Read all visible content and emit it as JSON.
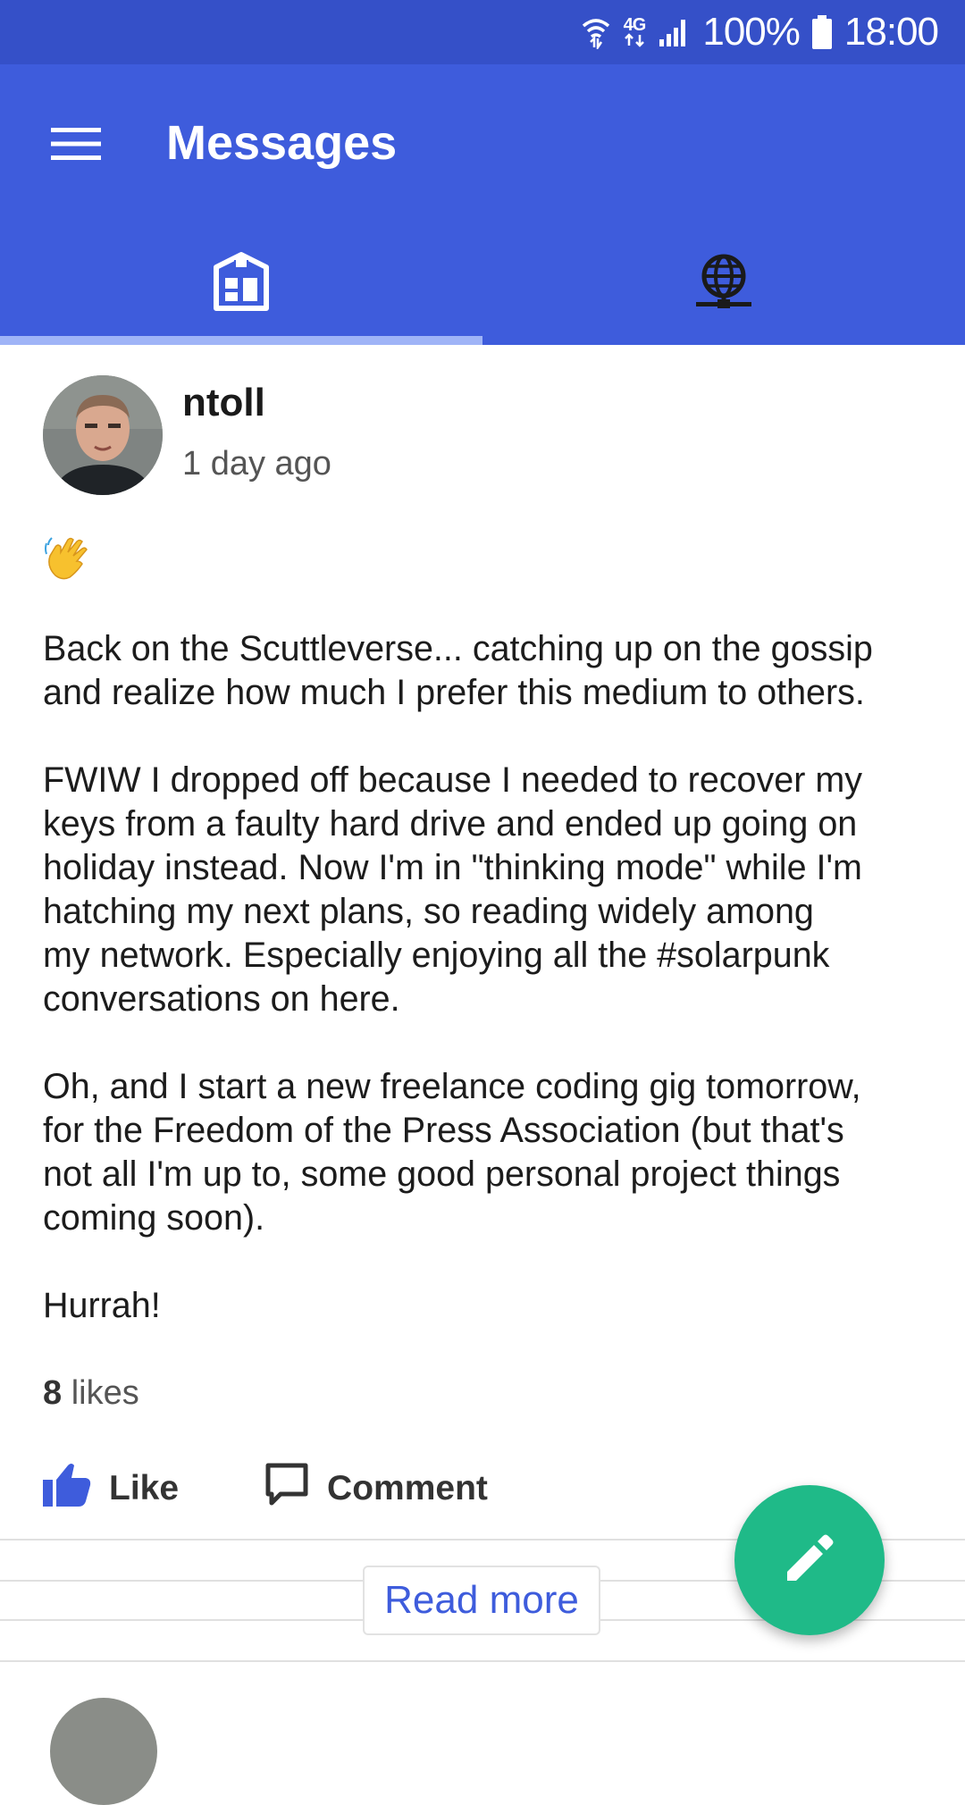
{
  "status_bar": {
    "network_label": "4G",
    "battery_text": "100%",
    "time": "18:00",
    "icons": [
      "wifi-icon",
      "network-4g-icon",
      "signal-icon",
      "battery-icon"
    ]
  },
  "app_bar": {
    "title": "Messages",
    "menu_icon": "hamburger-menu-icon",
    "background_color": "#3e5cdc",
    "tabs": [
      {
        "icon": "public-feed-icon",
        "selected": true
      },
      {
        "icon": "globe-network-icon",
        "selected": false
      }
    ]
  },
  "post": {
    "author": "ntoll",
    "timestamp": "1 day ago",
    "emoji": "👋",
    "paragraphs": [
      "Back on the Scuttleverse... catching up on the gossip\nand realize how much I prefer this medium to others.",
      "FWIW I dropped off because I needed to recover my\nkeys from a faulty hard drive and ended up going on\nholiday instead. Now I'm in \"thinking mode\" while I'm\nhatching my next plans, so reading widely among\nmy network. Especially enjoying all the #solarpunk\nconversations on here.",
      "Oh, and I start a new freelance coding gig tomorrow,\nfor the Freedom of the Press Association (but that's\nnot all I'm up to, some good personal project things\ncoming soon).",
      "Hurrah!"
    ],
    "likes_count": "8",
    "likes_label": "likes",
    "like_label": "Like",
    "comment_label": "Comment"
  },
  "read_more_label": "Read more",
  "fab": {
    "icon": "pencil-icon",
    "color": "#1fba88"
  }
}
